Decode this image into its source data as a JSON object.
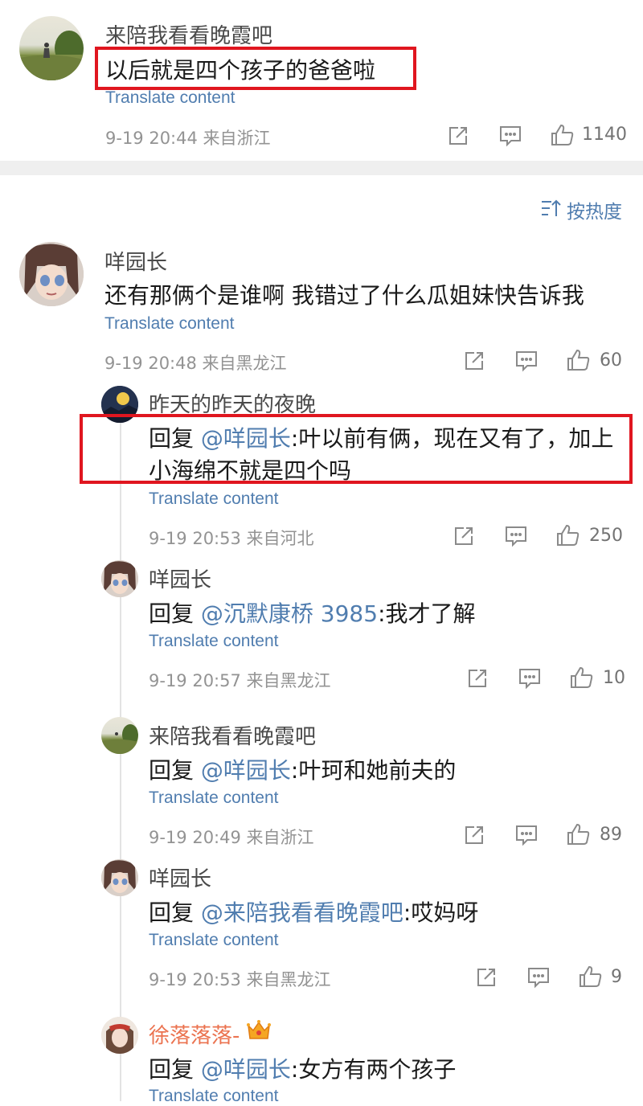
{
  "top_comment": {
    "author": "来陪我看看晚霞吧",
    "text": "以后就是四个孩子的爸爸啦",
    "translate": "Translate content",
    "meta": "9-19 20:44 来自浙江",
    "likes": "1140"
  },
  "sort": {
    "label": "按热度",
    "icon": "sort-icon"
  },
  "thread": {
    "author": "咩园长",
    "text": "还有那俩个是谁啊 我错过了什么瓜姐妹快告诉我",
    "translate": "Translate content",
    "meta": "9-19 20:48 来自黑龙江",
    "likes": "60",
    "replies": [
      {
        "author": "昨天的昨天的夜晚",
        "prefix": "回复 ",
        "mention": "@咩园长",
        "text_line1": ":叶以前有俩，现在又有了，加上",
        "text_line2": "小海绵不就是四个吗",
        "translate": "Translate content",
        "meta": "9-19 20:53 来自河北",
        "likes": "250"
      },
      {
        "author": "咩园长",
        "prefix": "回复 ",
        "mention": "@沉默康桥 3985",
        "text": ":我才了解",
        "translate": "Translate content",
        "meta": "9-19 20:57 来自黑龙江",
        "likes": "10"
      },
      {
        "author": "来陪我看看晚霞吧",
        "prefix": "回复 ",
        "mention": "@咩园长",
        "text": ":叶珂和她前夫的",
        "translate": "Translate content",
        "meta": "9-19 20:49 来自浙江",
        "likes": "89"
      },
      {
        "author": "咩园长",
        "prefix": "回复 ",
        "mention": "@来陪我看看晚霞吧",
        "text": ":哎妈呀",
        "translate": "Translate content",
        "meta": "9-19 20:53 来自黑龙江",
        "likes": "9"
      },
      {
        "author": "徐落落落-",
        "prefix": "回复 ",
        "mention": "@咩园长",
        "text": ":女方有两个孩子",
        "translate": "Translate content"
      }
    ]
  },
  "colors": {
    "link": "#507daf",
    "highlight_box": "#e0161f",
    "vip_name": "#eb7350"
  }
}
